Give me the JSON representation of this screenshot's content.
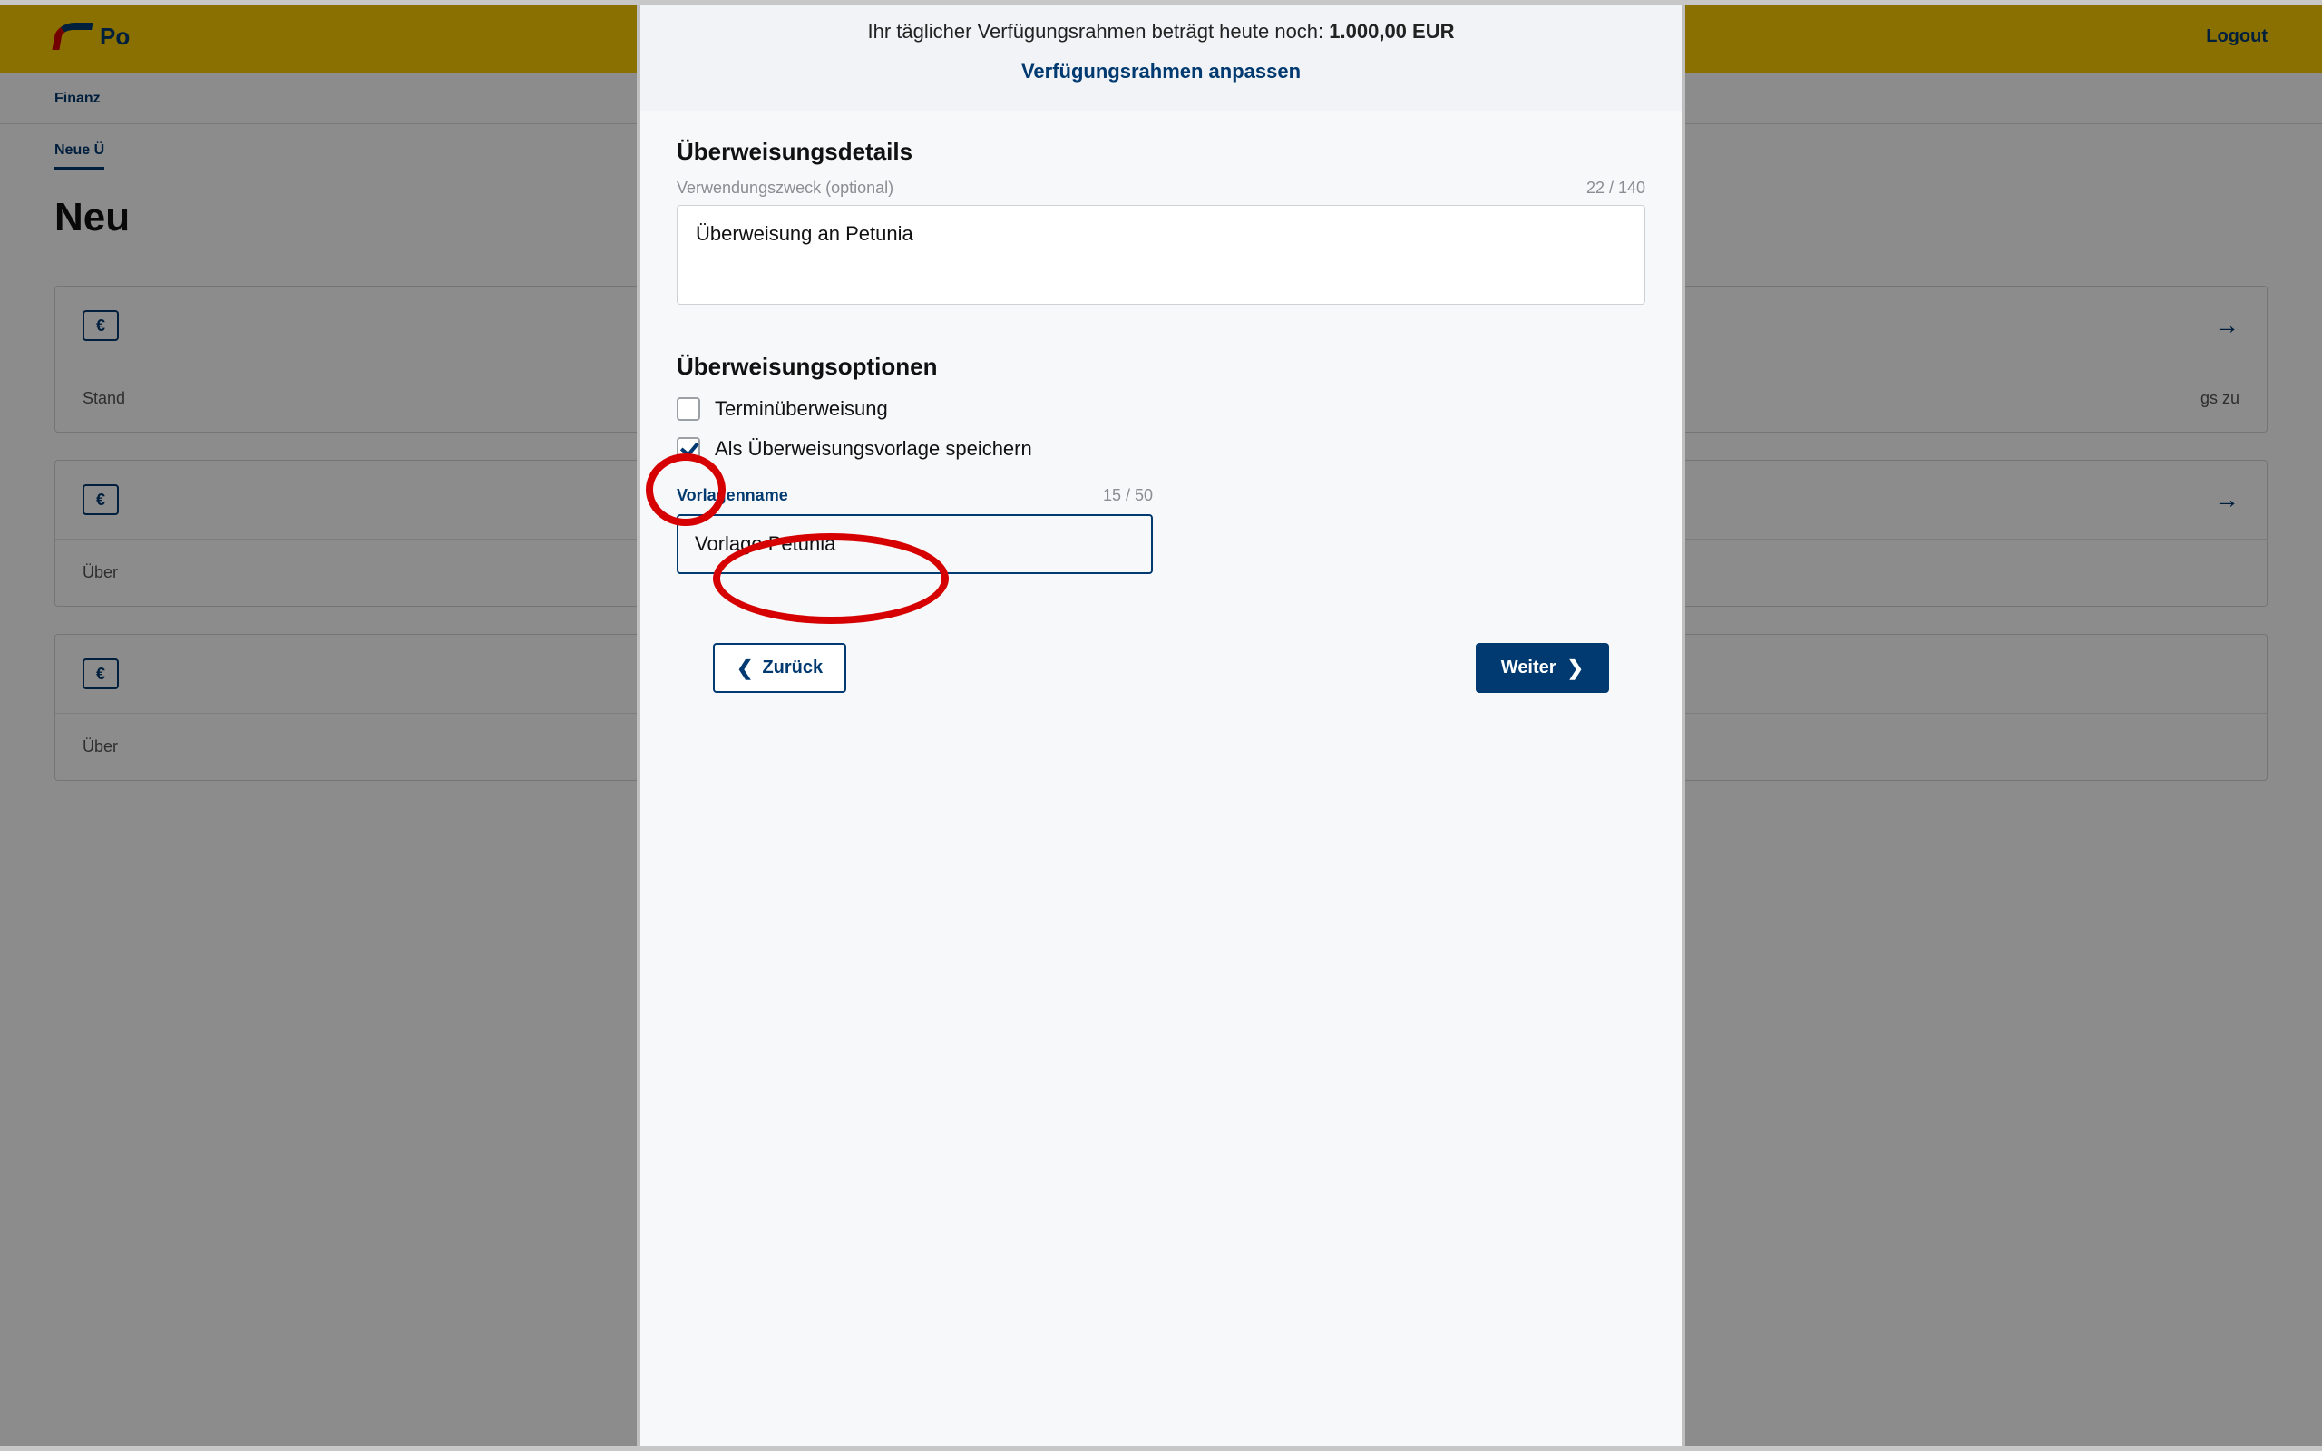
{
  "bg": {
    "brand_partial": "Po",
    "logout": "Logout",
    "tab_finance": "Finanz",
    "subtab_new": "Neue Ü",
    "h1": "Neu",
    "row_standard": "Stand",
    "row_uber": "Über",
    "row_uber2": "Über",
    "row_tail": "gs zu"
  },
  "limit": {
    "text_prefix": "Ihr täglicher Verfügungsrahmen beträgt heute noch: ",
    "amount": "1.000,00 EUR",
    "adjust": "Verfügungsrahmen anpassen"
  },
  "details": {
    "heading": "Überweisungsdetails",
    "purpose_label": "Verwendungszweck (optional)",
    "purpose_counter": "22 / 140",
    "purpose_value": "Überweisung an Petunia"
  },
  "options": {
    "heading": "Überweisungsoptionen",
    "scheduled_label": "Terminüberweisung",
    "scheduled_checked": false,
    "save_template_label": "Als Überweisungsvorlage speichern",
    "save_template_checked": true,
    "template_name_label": "Vorlagenname",
    "template_counter": "15 / 50",
    "template_value": "Vorlage Petunia"
  },
  "nav": {
    "back": "Zurück",
    "next": "Weiter"
  }
}
